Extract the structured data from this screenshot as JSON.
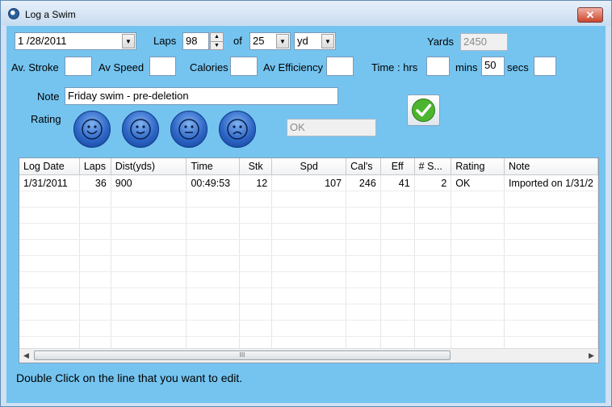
{
  "window": {
    "title": "Log a Swim",
    "close_label": "✕"
  },
  "form": {
    "date": "1 /28/2011",
    "laps_label": "Laps",
    "laps_value": "98",
    "of_label": "of",
    "pool_length": "25",
    "unit": "yd",
    "yards_label": "Yards",
    "yards_value": "2450",
    "stroke_label": "Av. Stroke",
    "speed_label": "Av Speed",
    "calories_label": "Calories",
    "efficiency_label": "Av Efficiency",
    "time_label": "Time  : hrs",
    "mins_label": "mins",
    "mins_value": "50",
    "secs_label": "secs",
    "note_label": "Note",
    "note_value": "Friday swim - pre-deletion",
    "rating_label": "Rating",
    "rating_value": "OK"
  },
  "grid": {
    "columns": [
      "Log Date",
      "Laps",
      "Dist(yds)",
      "Time",
      "Stk",
      "Spd",
      "Cal's",
      "Eff",
      "# S...",
      "Rating",
      "Note"
    ],
    "rows": [
      {
        "log_date": "1/31/2011",
        "laps": "36",
        "dist": "900",
        "time": "00:49:53",
        "stk": "12",
        "spd": "107",
        "cals": "246",
        "eff": "41",
        "num_s": "2",
        "rating": "OK",
        "note": "Imported on 1/31/2"
      }
    ],
    "scroll_thumb_glyph": "III"
  },
  "status_text": "Double Click on the line that you want to edit.",
  "icons": {
    "rating": [
      "very-happy-face-icon",
      "happy-face-icon",
      "neutral-face-icon",
      "sad-face-icon"
    ],
    "ok": "green-check-icon"
  },
  "colors": {
    "background": "#75c4f0",
    "check": "#3fa82c"
  }
}
